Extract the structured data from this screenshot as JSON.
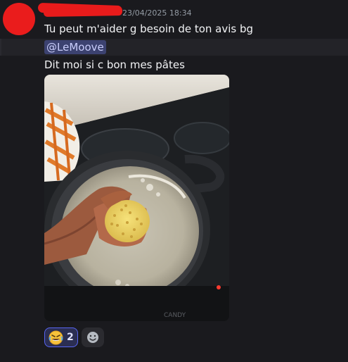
{
  "message": {
    "timestamp": "23/04/2025 18:34",
    "line1": "Tu peut m'aider g besoin de ton avis bg",
    "mention": "@LeMoove",
    "line2": "Dit moi si c bon mes pâtes",
    "attachment_icon": "photo-pasta-pot",
    "attachment_watermark": "CANDY"
  },
  "reactions": [
    {
      "emoji": "rolling-on-floor-laughing-emoji",
      "count": "2",
      "active": true
    }
  ],
  "add_reaction_icon": "smiley-add-reaction-icon",
  "colors": {
    "background": "#1a1a1e",
    "mention_bg": "#3c4270",
    "mention_text": "#c9cdfb",
    "reaction_border": "#5865f2",
    "avatar": "#ea1c1c"
  }
}
